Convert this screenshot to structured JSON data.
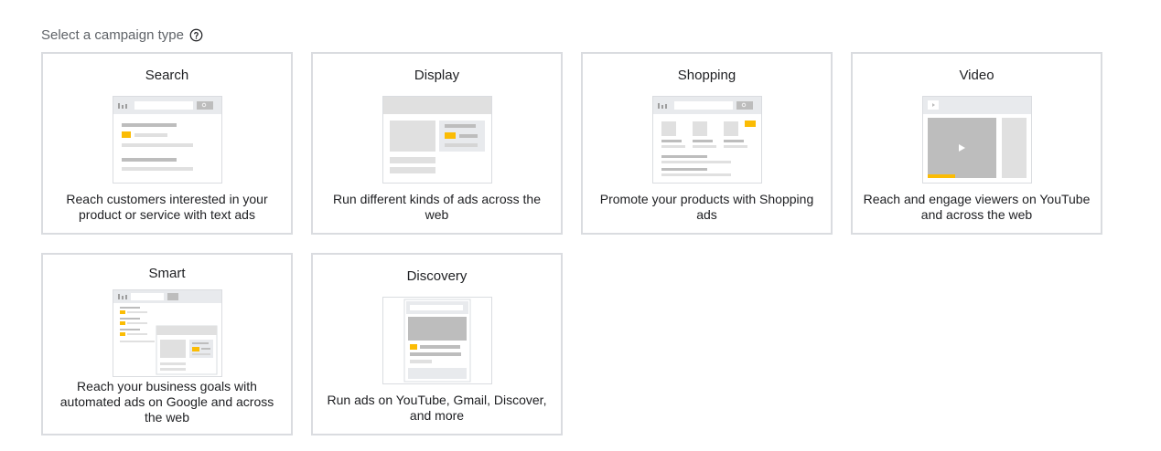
{
  "header": {
    "label": "Select a campaign type",
    "help_icon": "help-circle-icon"
  },
  "colors": {
    "card_border": "#dadce0",
    "illustration_gray": "#bdbdbd",
    "illustration_light": "#e0e0e0",
    "accent_yellow": "#fbbc04"
  },
  "campaign_types": [
    {
      "title": "Search",
      "description": "Reach customers interested in your product or service with text ads"
    },
    {
      "title": "Display",
      "description": "Run different kinds of ads across the web"
    },
    {
      "title": "Shopping",
      "description": "Promote your products with Shopping ads"
    },
    {
      "title": "Video",
      "description": "Reach and engage viewers on YouTube and across the web"
    },
    {
      "title": "Smart",
      "description": "Reach your business goals with automated ads on Google and across the web"
    },
    {
      "title": "Discovery",
      "description": "Run ads on YouTube, Gmail, Discover, and more"
    }
  ]
}
